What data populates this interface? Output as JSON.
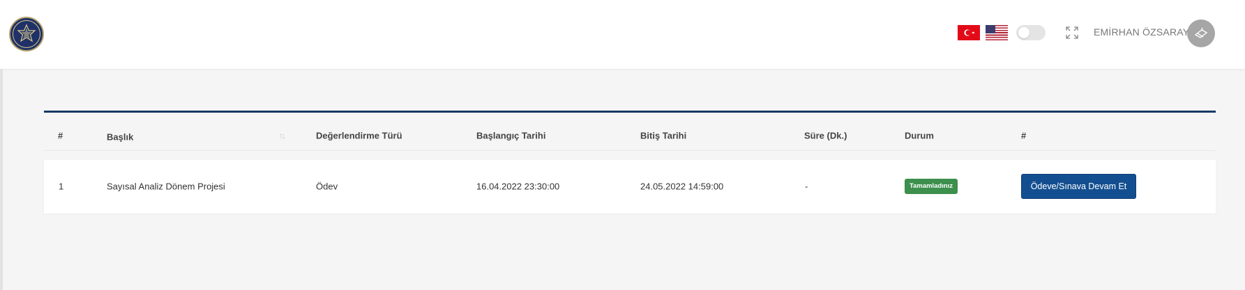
{
  "header": {
    "user_name": "EMİRHAN ÖZSARAY",
    "icons": {
      "logo": "university-seal-icon",
      "lang_tr": "turkish-flag-icon",
      "lang_en": "us-flag-icon",
      "theme": "toggle-switch",
      "fullscreen": "expand-icon",
      "avatar": "user-avatar-icon"
    }
  },
  "table": {
    "columns": [
      "#",
      "Başlık",
      "Değerlendirme Türü",
      "Başlangıç Tarihi",
      "Bitiş Tarihi",
      "Süre (Dk.)",
      "Durum",
      "#"
    ],
    "rows": [
      {
        "index": "1",
        "title": "Sayısal Analiz Dönem Projesi",
        "type": "Ödev",
        "start": "16.04.2022 23:30:00",
        "end": "24.05.2022 14:59:00",
        "duration": "-",
        "status": "Tamamladınız",
        "action": "Ödeve/Sınava Devam Et"
      }
    ]
  },
  "colors": {
    "accent": "#143a66",
    "button": "#134f90",
    "status_done": "#3d8f4d",
    "flag_tr": "#e30a17"
  }
}
